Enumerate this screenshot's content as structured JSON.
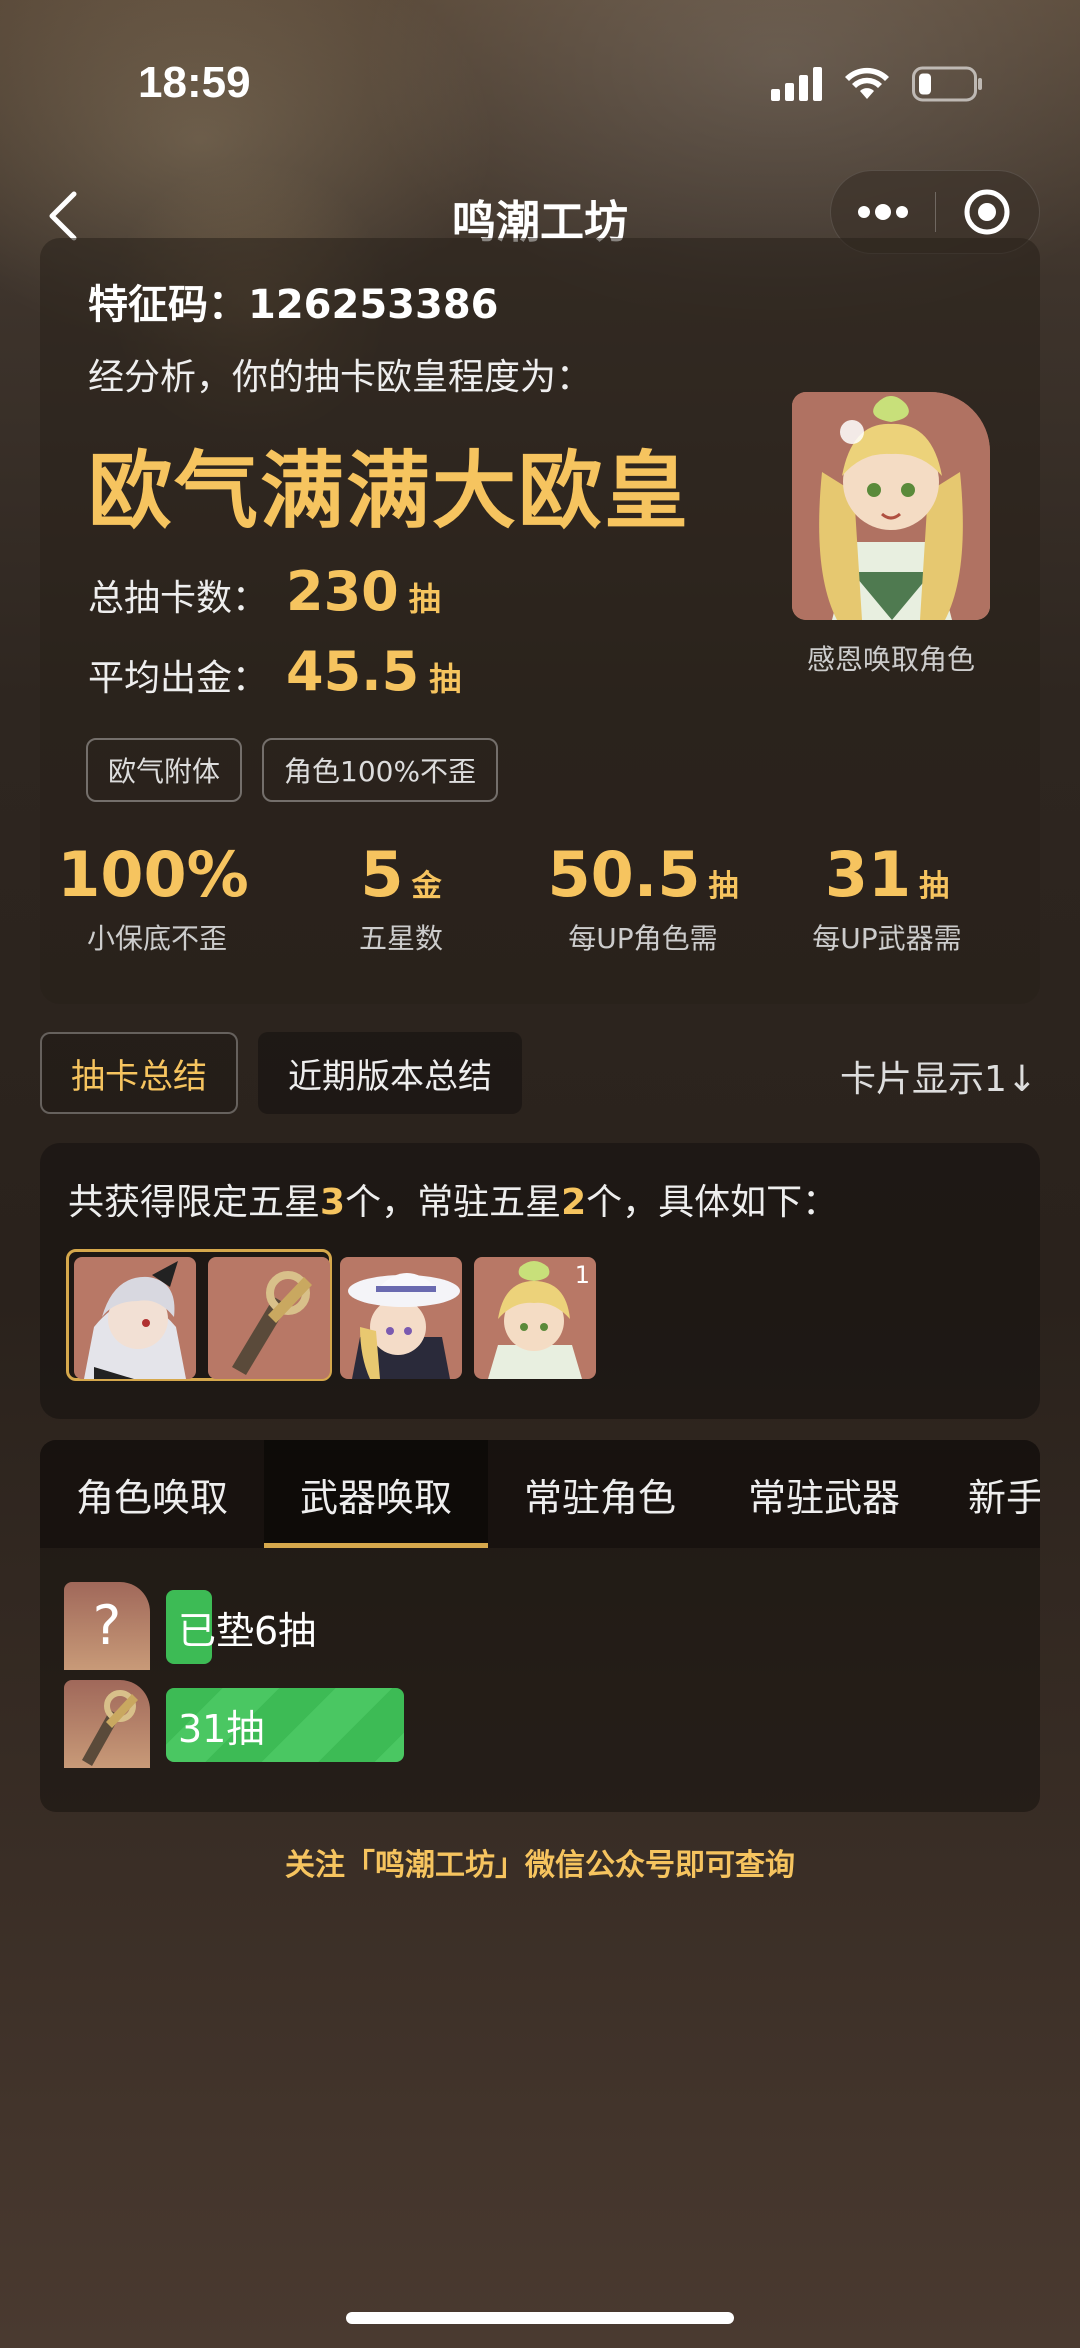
{
  "status_bar": {
    "time": "18:59"
  },
  "nav": {
    "title": "鸣潮工坊"
  },
  "summary": {
    "id_line": "特征码：126253386",
    "analysis": "经分析，你的抽卡欧皇程度为：",
    "rank": "欧气满满大欧皇",
    "total_label": "总抽卡数：",
    "total_value": "230",
    "total_unit": "抽",
    "avg_label": "平均出金：",
    "avg_value": "45.5",
    "avg_unit": "抽",
    "tags": [
      "欧气附体",
      "角色100%不歪"
    ],
    "portrait_caption": "感恩唤取角色",
    "stats": [
      {
        "value": "100%",
        "unit": "",
        "label": "小保底不歪"
      },
      {
        "value": "5",
        "unit": "金",
        "label": "五星数"
      },
      {
        "value": "50.5",
        "unit": "抽",
        "label": "每UP角色需"
      },
      {
        "value": "31",
        "unit": "抽",
        "label": "每UP武器需"
      }
    ]
  },
  "segment_tabs": {
    "active": "抽卡总结",
    "inactive": "近期版本总结",
    "card_toggle": "卡片显示1↓"
  },
  "five_star": {
    "prefix": "共获得限定五星",
    "limited_count": "3",
    "middle": "个，常驻五星",
    "standard_count": "2",
    "suffix": "个，具体如下：",
    "badge": "1"
  },
  "pool_tabs": [
    "角色唤取",
    "武器唤取",
    "常驻角色",
    "常驻武器",
    "新手"
  ],
  "pool_active_index": 1,
  "pulls": [
    {
      "text": "已垫6抽",
      "icon": "unknown-icon",
      "progress": 0.06
    },
    {
      "text": "31抽",
      "icon": "weapon-icon",
      "progress": 0.39
    }
  ],
  "footer": "关注「鸣潮工坊」微信公众号即可查询",
  "colors": {
    "accent": "#f6c45f",
    "green": "#3dbb55",
    "gold_border": "#d6a84c"
  }
}
